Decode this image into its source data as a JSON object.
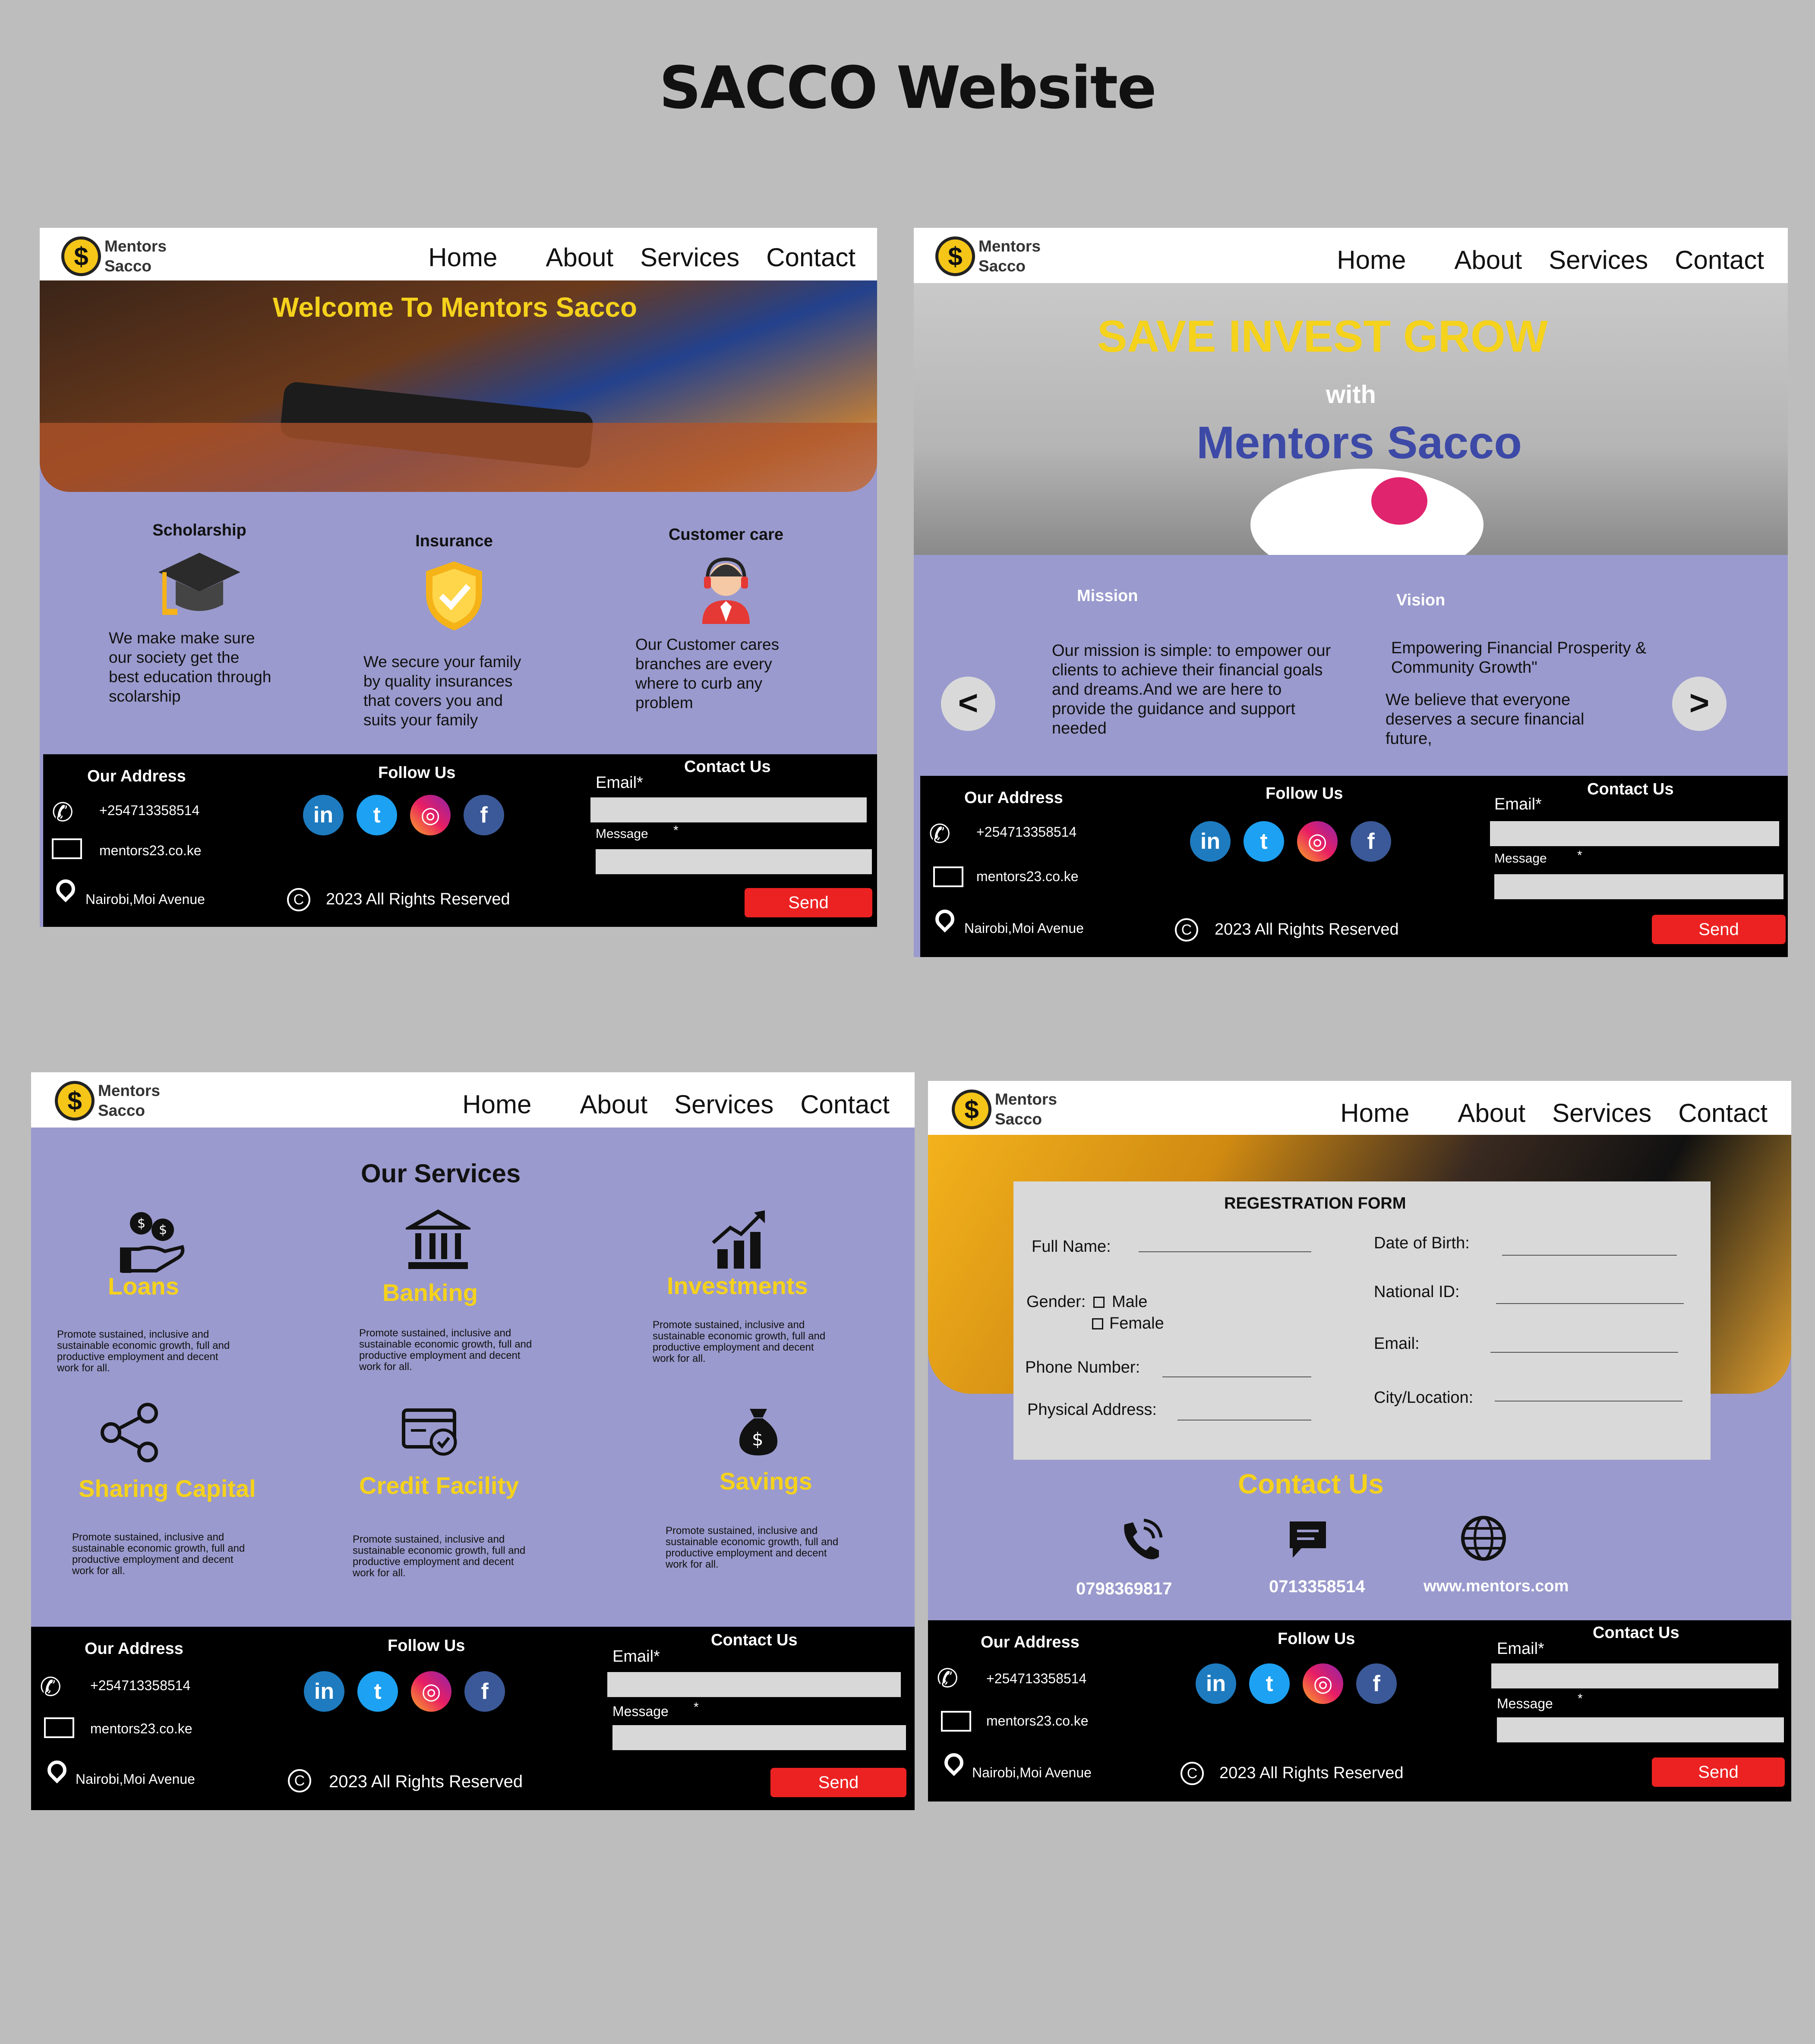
{
  "page_title": "SACCO Website",
  "common": {
    "logo": {
      "line1": "Mentors",
      "line2": "Sacco",
      "symbol": "$"
    },
    "nav": [
      "Home",
      "About",
      "Services",
      "Contact"
    ],
    "footer": {
      "address_heading": "Our Address",
      "phone": "+254713358514",
      "email": "mentors23.co.ke",
      "location": "Nairobi,Moi Avenue",
      "follow_heading": "Follow Us",
      "copyright": "2023 All Rights Reserved",
      "contact_heading": "Contact Us",
      "email_label": "Email*",
      "message_label": "Message",
      "message_star": "*",
      "send": "Send",
      "social_icons": [
        "linkedin-icon",
        "twitter-icon",
        "instagram-icon",
        "facebook-icon"
      ]
    }
  },
  "colors": {
    "lavender": "#9a9ace",
    "yellow": "#f5d21c",
    "brand_blue": "#3c49a6",
    "send_red": "#ec2222",
    "footer_black": "#000000"
  },
  "screen1": {
    "hero_text": "Welcome To Mentors Sacco",
    "cards": [
      {
        "title": "Scholarship",
        "icon": "graduation-cap-icon",
        "text": "We make make sure our society get the best education through scolarship"
      },
      {
        "title": "Insurance",
        "icon": "shield-check-icon",
        "text": "We secure your family by quality insurances that covers you and suits your family"
      },
      {
        "title": "Customer care",
        "icon": "support-agent-icon",
        "text": "Our Customer cares branches are every where to curb any problem"
      }
    ]
  },
  "screen2": {
    "hero_line1": "SAVE INVEST GROW",
    "hero_line2": "with",
    "hero_line3": "Mentors Sacco",
    "mission_title": "Mission",
    "mission_text": "Our mission is simple: to empower our clients to achieve their financial goals and dreams.And we are here to provide the guidance and support needed",
    "vision_title": "Vision",
    "vision_text1": "Empowering Financial Prosperity & Community Growth\"",
    "vision_text2": "We believe that everyone deserves a secure financial future,",
    "prev": "<",
    "next": ">"
  },
  "screen3": {
    "heading": "Our Services",
    "services": [
      {
        "title": "Loans",
        "icon": "loans-icon",
        "text": "Promote sustained, inclusive and sustainable economic growth, full and productive employment and decent work for all."
      },
      {
        "title": "Banking",
        "icon": "bank-icon",
        "text": "Promote sustained, inclusive and sustainable economic growth, full and productive employment and decent work for all."
      },
      {
        "title": "Investments",
        "icon": "investment-chart-icon",
        "text": "Promote sustained, inclusive and sustainable economic growth, full and productive employment and decent work for all."
      },
      {
        "title": "Sharing Capital",
        "icon": "share-icon",
        "text": "Promote sustained, inclusive and sustainable economic growth, full and productive employment and decent work for all."
      },
      {
        "title": "Credit Facility",
        "icon": "credit-facility-icon",
        "text": "Promote sustained, inclusive and sustainable economic growth, full and productive employment and decent work for all."
      },
      {
        "title": "Savings",
        "icon": "money-bag-icon",
        "text": "Promote sustained, inclusive and sustainable economic growth, full and productive employment and decent work for all."
      }
    ]
  },
  "screen4": {
    "form_title": "REGESTRATION FORM",
    "full_name": "Full Name:",
    "gender": "Gender:",
    "male": "Male",
    "female": "Female",
    "phone_number": "Phone Number:",
    "physical_address": "Physical Address:",
    "dob": "Date of Birth:",
    "national_id": "National ID:",
    "email": "Email:",
    "city": "City/Location:",
    "contact_heading": "Contact Us",
    "contact_phone": "0798369817",
    "contact_sms": "0713358514",
    "contact_web": "www.mentors.com"
  }
}
